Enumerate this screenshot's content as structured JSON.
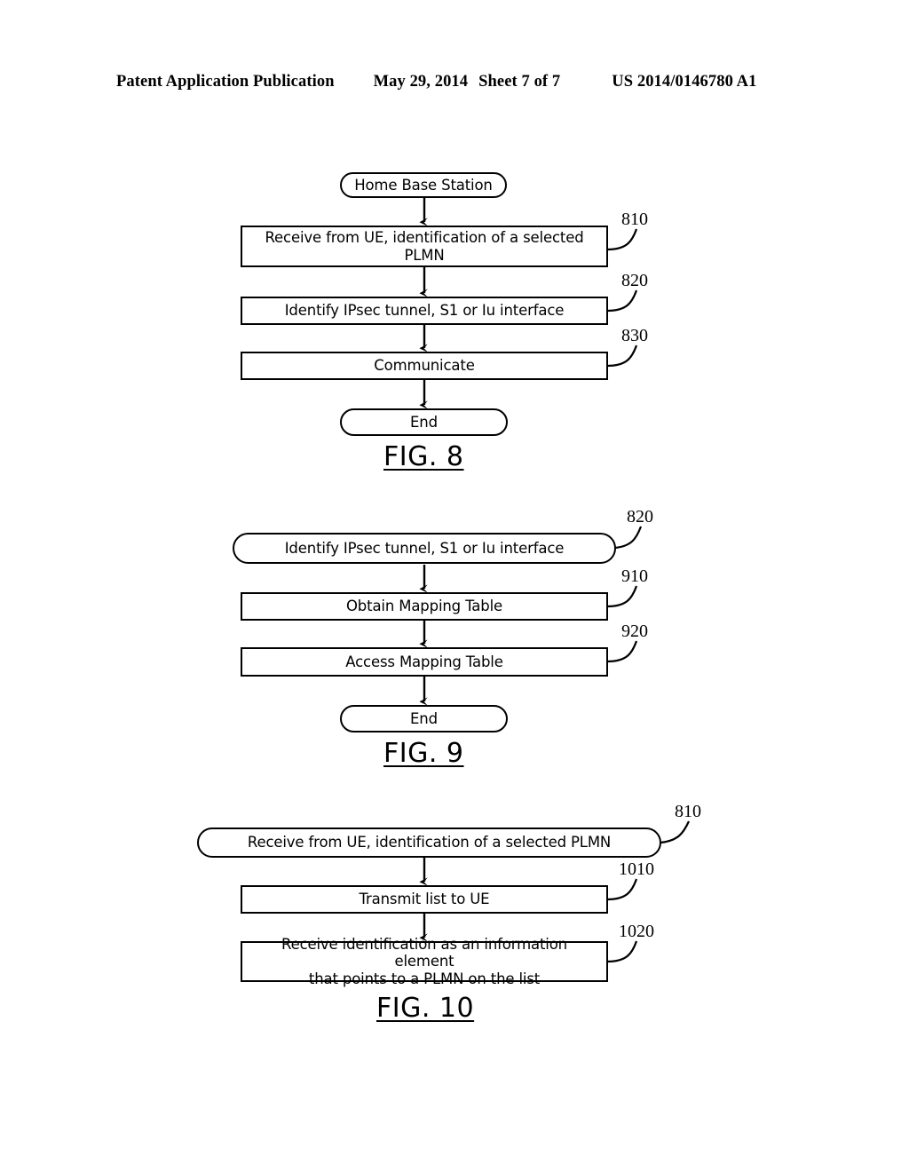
{
  "header": {
    "publication": "Patent Application Publication",
    "date": "May 29, 2014",
    "sheet": "Sheet 7 of 7",
    "patent_number": "US 2014/0146780 A1"
  },
  "figures": [
    {
      "caption": "FIG. 8",
      "nodes": [
        {
          "id": "fig8-start",
          "shape": "rounded",
          "label": "Home Base Station"
        },
        {
          "id": "fig8-step1",
          "shape": "rect",
          "label": "Receive from UE, identification of a selected\nPLMN",
          "ref": "810"
        },
        {
          "id": "fig8-step2",
          "shape": "rect",
          "label": "Identify IPsec tunnel, S1 or Iu interface",
          "ref": "820"
        },
        {
          "id": "fig8-step3",
          "shape": "rect",
          "label": "Communicate",
          "ref": "830"
        },
        {
          "id": "fig8-end",
          "shape": "rounded",
          "label": "End"
        }
      ]
    },
    {
      "caption": "FIG. 9",
      "nodes": [
        {
          "id": "fig9-start",
          "shape": "rounded",
          "label": "Identify IPsec tunnel, S1 or Iu interface",
          "ref": "820"
        },
        {
          "id": "fig9-step1",
          "shape": "rect",
          "label": "Obtain Mapping Table",
          "ref": "910"
        },
        {
          "id": "fig9-step2",
          "shape": "rect",
          "label": "Access Mapping Table",
          "ref": "920"
        },
        {
          "id": "fig9-end",
          "shape": "rounded",
          "label": "End"
        }
      ]
    },
    {
      "caption": "FIG. 10",
      "nodes": [
        {
          "id": "fig10-start",
          "shape": "rounded",
          "label": "Receive from UE, identification of a selected PLMN",
          "ref": "810"
        },
        {
          "id": "fig10-step1",
          "shape": "rect",
          "label": "Transmit list to UE",
          "ref": "1010"
        },
        {
          "id": "fig10-step2",
          "shape": "rect",
          "label": "Receive identification as an information element\nthat points to a PLMN on the list",
          "ref": "1020"
        }
      ]
    }
  ]
}
